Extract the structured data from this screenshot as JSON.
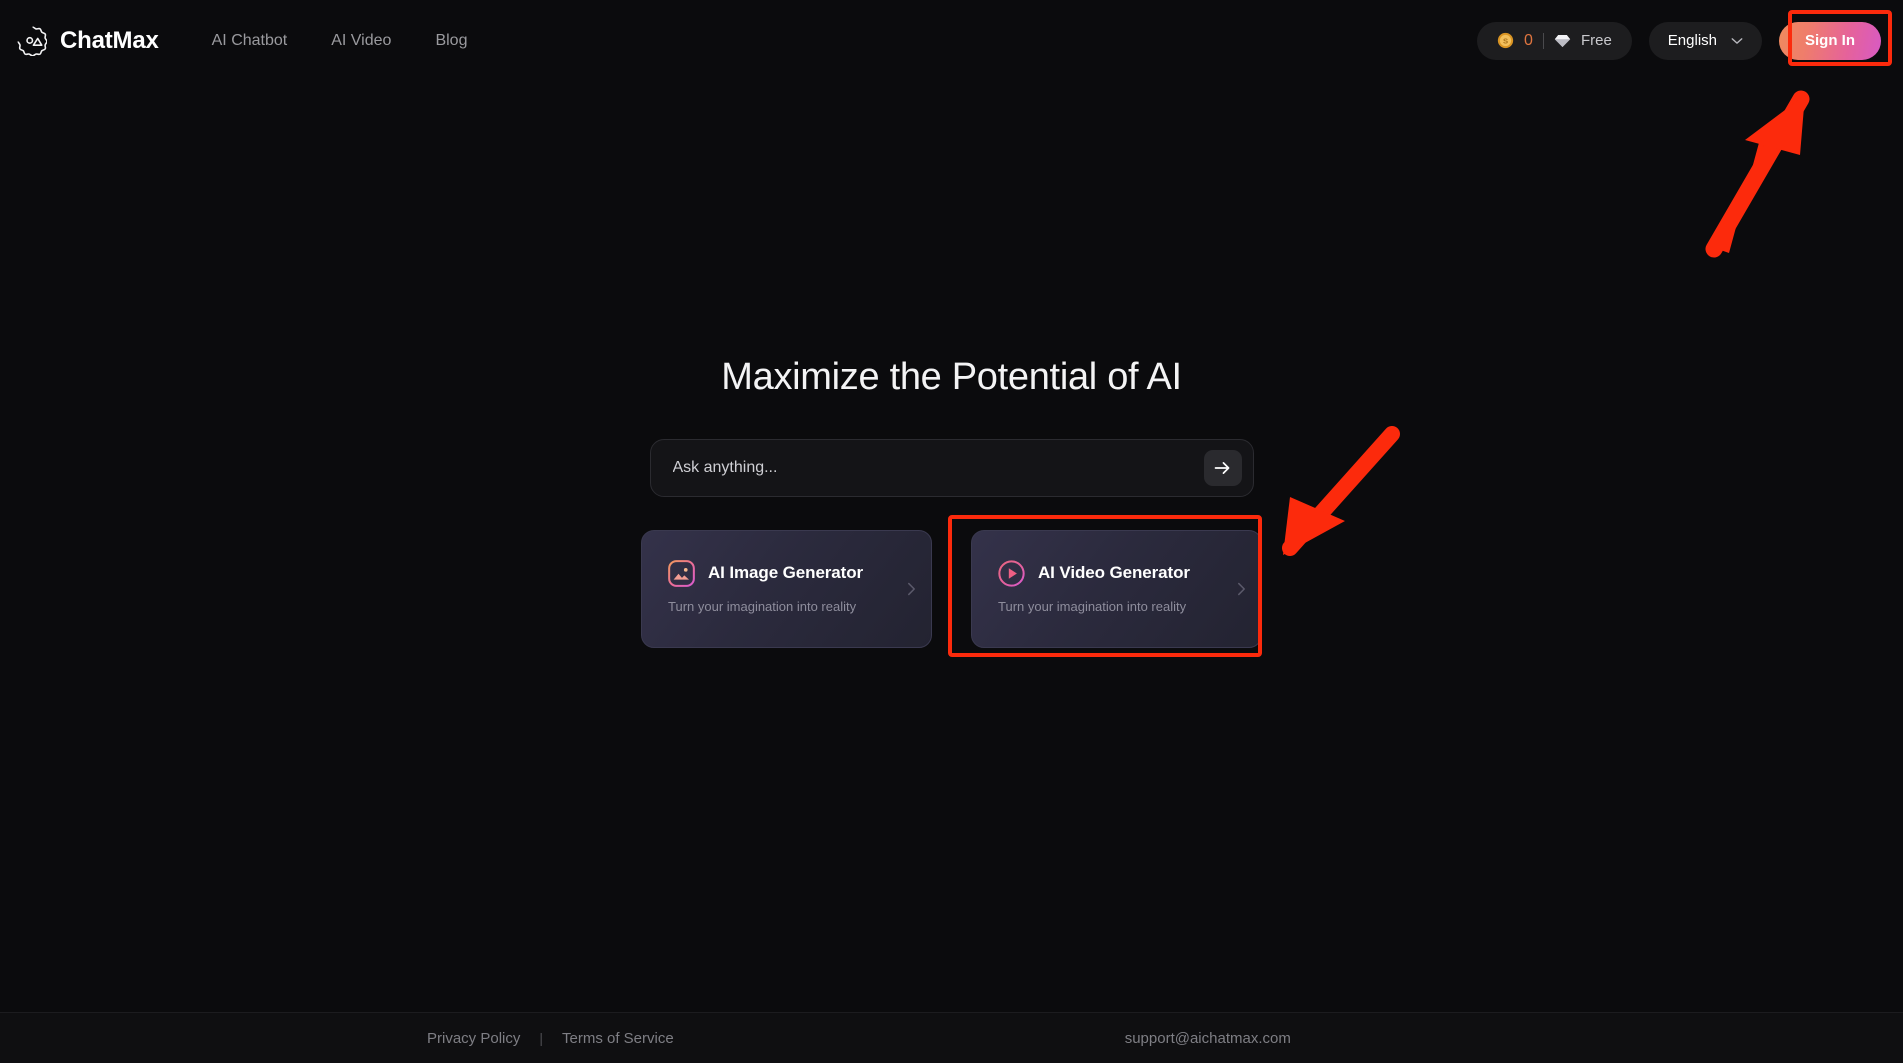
{
  "brand": {
    "name": "ChatMax",
    "logo_icon": "gear-logo-icon"
  },
  "nav": {
    "items": [
      {
        "label": "AI Chatbot"
      },
      {
        "label": "AI Video"
      },
      {
        "label": "Blog"
      }
    ]
  },
  "header_right": {
    "credits": {
      "coin_icon": "coin-icon",
      "count": "0",
      "count_color": "#e0753f"
    },
    "plan": {
      "diamond_icon": "diamond-icon",
      "label": "Free"
    },
    "language": {
      "label": "English",
      "chevron_icon": "chevron-down-icon"
    },
    "sign_in": {
      "label": "Sign In",
      "gradient_from": "#ef8a5e",
      "gradient_to": "#d85ac4"
    }
  },
  "hero": {
    "title": "Maximize the Potential of AI",
    "ask": {
      "placeholder": "Ask anything...",
      "value": "",
      "send_icon": "arrow-right-icon"
    },
    "cards": [
      {
        "icon": "image-icon",
        "title": "AI Image Generator",
        "subtitle": "Turn your imagination into reality",
        "chevron_icon": "chevron-right-icon"
      },
      {
        "icon": "play-circle-icon",
        "title": "AI Video Generator",
        "subtitle": "Turn your imagination into reality",
        "chevron_icon": "chevron-right-icon"
      }
    ]
  },
  "footer": {
    "privacy_label": "Privacy Policy",
    "separator": "|",
    "terms_label": "Terms of Service",
    "email": "support@aichatmax.com"
  },
  "annotations": {
    "color": "#fc2a0c",
    "highlight_sign_in": "Sign In button highlighted",
    "highlight_video_card": "AI Video Generator card highlighted",
    "arrow_to_sign_in": "arrow-up-right-icon",
    "arrow_to_video_card": "arrow-down-left-icon"
  }
}
